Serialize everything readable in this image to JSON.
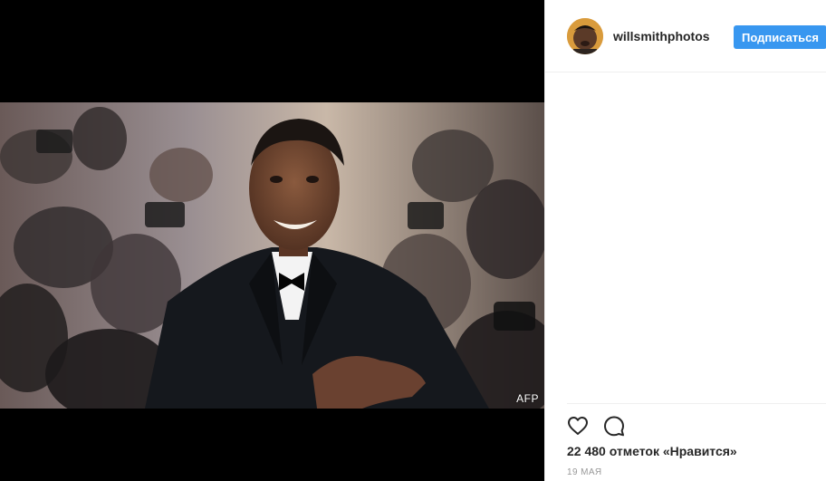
{
  "post": {
    "username": "willsmithphotos",
    "follow_label": "Подписаться",
    "watermark": "AFP",
    "likes_text": "22 480 отметок «Нравится»",
    "date": "19 МАЯ"
  },
  "icons": {
    "like": "heart-icon",
    "comment": "comment-icon"
  },
  "colors": {
    "follow_button": "#3897f0",
    "text": "#262626",
    "muted": "#999999",
    "media_background": "#000000"
  }
}
